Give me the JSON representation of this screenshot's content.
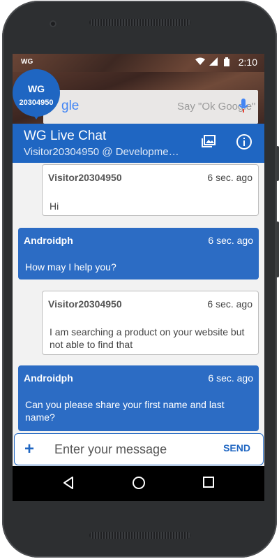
{
  "status_bar": {
    "app_icon": "WG",
    "time": "2:10",
    "icons": [
      "wifi-icon",
      "signal-icon",
      "battery-icon"
    ]
  },
  "home_screen": {
    "search_logo": "gle",
    "search_hint": "Say \"Ok Google\""
  },
  "badge": {
    "logo": "WG",
    "visitor_number": "20304950"
  },
  "header": {
    "title": "WG Live Chat",
    "subtitle": "Visitor20304950 @ Developme…"
  },
  "messages": [
    {
      "type": "visitor",
      "name": "Visitor20304950",
      "time": "6 sec. ago",
      "text": "Hi"
    },
    {
      "type": "agent",
      "name": "Androidph",
      "time": "6 sec. ago",
      "text": "How may I help you?"
    },
    {
      "type": "visitor",
      "name": "Visitor20304950",
      "time": "6 sec. ago",
      "text": "I am searching a product on your website but not able to find that"
    },
    {
      "type": "agent",
      "name": "Androidph",
      "time": "6 sec. ago",
      "text": "Can you please share your first name and last name?"
    }
  ],
  "input": {
    "placeholder": "Enter your message",
    "add_label": "+",
    "send_label": "SEND"
  },
  "colors": {
    "primary": "#1f66c2",
    "agent_bubble": "#2c6cc4",
    "visitor_bubble": "#ffffff"
  }
}
